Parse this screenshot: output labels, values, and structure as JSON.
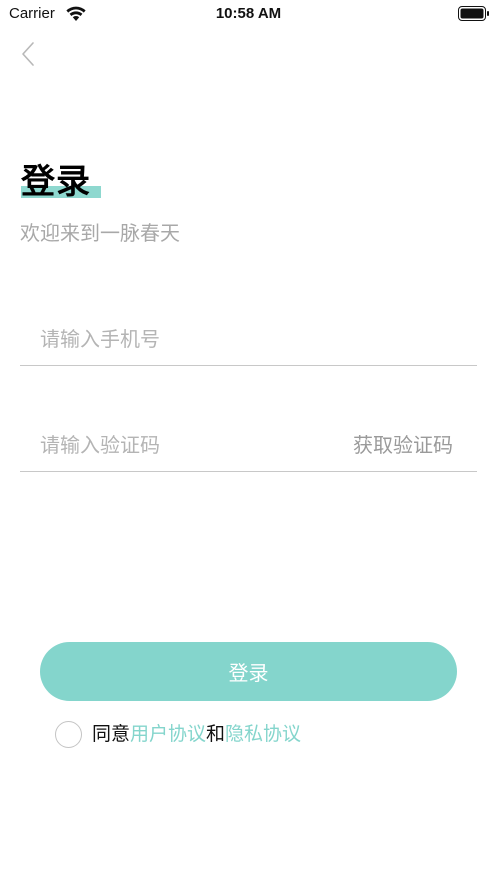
{
  "status_bar": {
    "carrier": "Carrier",
    "time": "10:58 AM"
  },
  "nav": {
    "back_icon": "chevron-left-icon"
  },
  "header": {
    "title": "登录",
    "subtitle": "欢迎来到一脉春天"
  },
  "form": {
    "phone_placeholder": "请输入手机号",
    "phone_value": "",
    "code_placeholder": "请输入验证码",
    "code_value": "",
    "get_code_label": "获取验证码"
  },
  "actions": {
    "login_label": "登录"
  },
  "agreement": {
    "checked": false,
    "prefix": "同意",
    "user_agreement": "用户协议",
    "conjunction": "和",
    "privacy_agreement": "隐私协议"
  },
  "colors": {
    "accent": "#84d5cc",
    "title_highlight": "#8ed8cf",
    "placeholder": "#b4b4b4",
    "divider": "#c8c8c8"
  }
}
